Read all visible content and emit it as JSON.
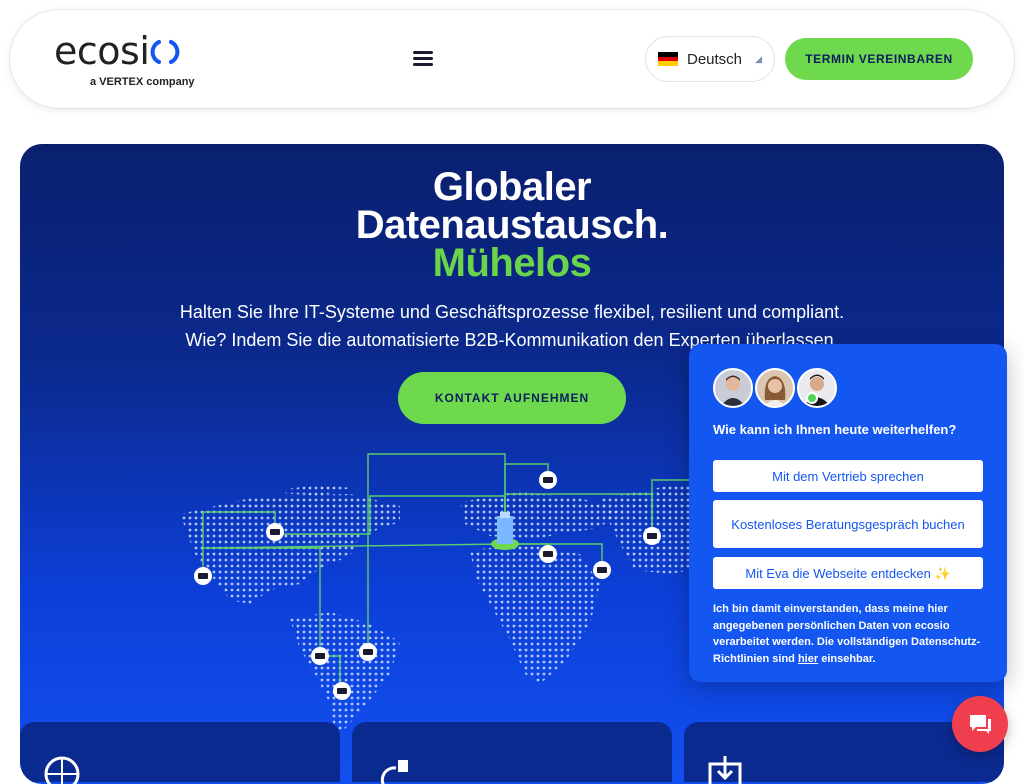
{
  "header": {
    "logo_text": "ecosio",
    "logo_tagline": "a VERTEX company",
    "menu_icon": "hamburger-icon",
    "language": {
      "label": "Deutsch",
      "flag": "flag-germany-icon"
    },
    "cta_label": "TERMIN VEREINBAREN"
  },
  "hero": {
    "title_line1": "Globaler",
    "title_line2": "Datenaustausch.",
    "title_line3": "Mühelos",
    "subtitle_line1": "Halten Sie Ihre IT-Systeme und Geschäftsprozesse flexibel, resilient und compliant.",
    "subtitle_line2": "Wie? Indem Sie die automatisierte B2B-Kommunikation den Experten überlassen.",
    "cta_label": "KONTAKT AUFNEHMEN"
  },
  "chat": {
    "question": "Wie kann ich Ihnen heute weiterhelfen?",
    "options": [
      "Mit dem Vertrieb sprechen",
      "Kostenloses Beratungsgespräch buchen",
      "Mit Eva die Webseite entdecken ✨"
    ],
    "consent_text": "Ich bin damit einverstanden, dass meine hier angegebenen persönlichen Daten von ecosio verarbeitet werden. Die vollständigen Datenschutz-Richtlinien sind ",
    "consent_link": "hier",
    "consent_suffix": " einsehbar."
  },
  "colors": {
    "accent_green": "#6fd94e",
    "hero_blue": "#0b2a8f",
    "chat_blue": "#1356f0",
    "chat_fab_red": "#ef3f4f"
  }
}
